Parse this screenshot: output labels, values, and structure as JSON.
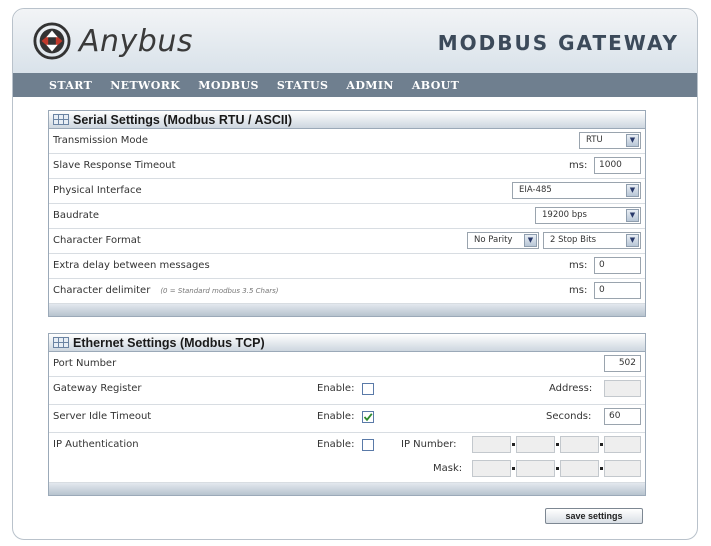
{
  "header": {
    "brand": "Anybus",
    "product": "MODBUS GATEWAY"
  },
  "nav": [
    "START",
    "NETWORK",
    "MODBUS",
    "STATUS",
    "ADMIN",
    "ABOUT"
  ],
  "serial": {
    "title": "Serial Settings (Modbus RTU / ASCII)",
    "transmission_mode": {
      "label": "Transmission Mode",
      "value": "RTU"
    },
    "slave_timeout": {
      "label": "Slave Response Timeout",
      "unit": "ms:",
      "value": "1000"
    },
    "physical_interface": {
      "label": "Physical Interface",
      "value": "EIA-485"
    },
    "baudrate": {
      "label": "Baudrate",
      "value": "19200 bps"
    },
    "character_format": {
      "label": "Character Format",
      "parity": "No Parity",
      "stop_bits": "2 Stop Bits"
    },
    "extra_delay": {
      "label": "Extra delay between messages",
      "unit": "ms:",
      "value": "0"
    },
    "char_delimiter": {
      "label": "Character delimiter",
      "note": "(0 = Standard modbus 3.5 Chars)",
      "unit": "ms:",
      "value": "0"
    }
  },
  "ethernet": {
    "title": "Ethernet Settings (Modbus TCP)",
    "port_number": {
      "label": "Port Number",
      "value": "502"
    },
    "gateway_register": {
      "label": "Gateway Register",
      "enable_label": "Enable:",
      "checked": false,
      "address_label": "Address:",
      "address_value": ""
    },
    "server_idle_timeout": {
      "label": "Server Idle Timeout",
      "enable_label": "Enable:",
      "checked": true,
      "seconds_label": "Seconds:",
      "seconds_value": "60"
    },
    "ip_auth": {
      "label": "IP Authentication",
      "enable_label": "Enable:",
      "checked": false,
      "ip_label": "IP Number:",
      "mask_label": "Mask:"
    }
  },
  "save_label": "save settings",
  "colors": {
    "nav_bg": "#6f7f8f",
    "panel_border": "#9ba9b8",
    "checkbox_check": "#2e8b2e"
  }
}
